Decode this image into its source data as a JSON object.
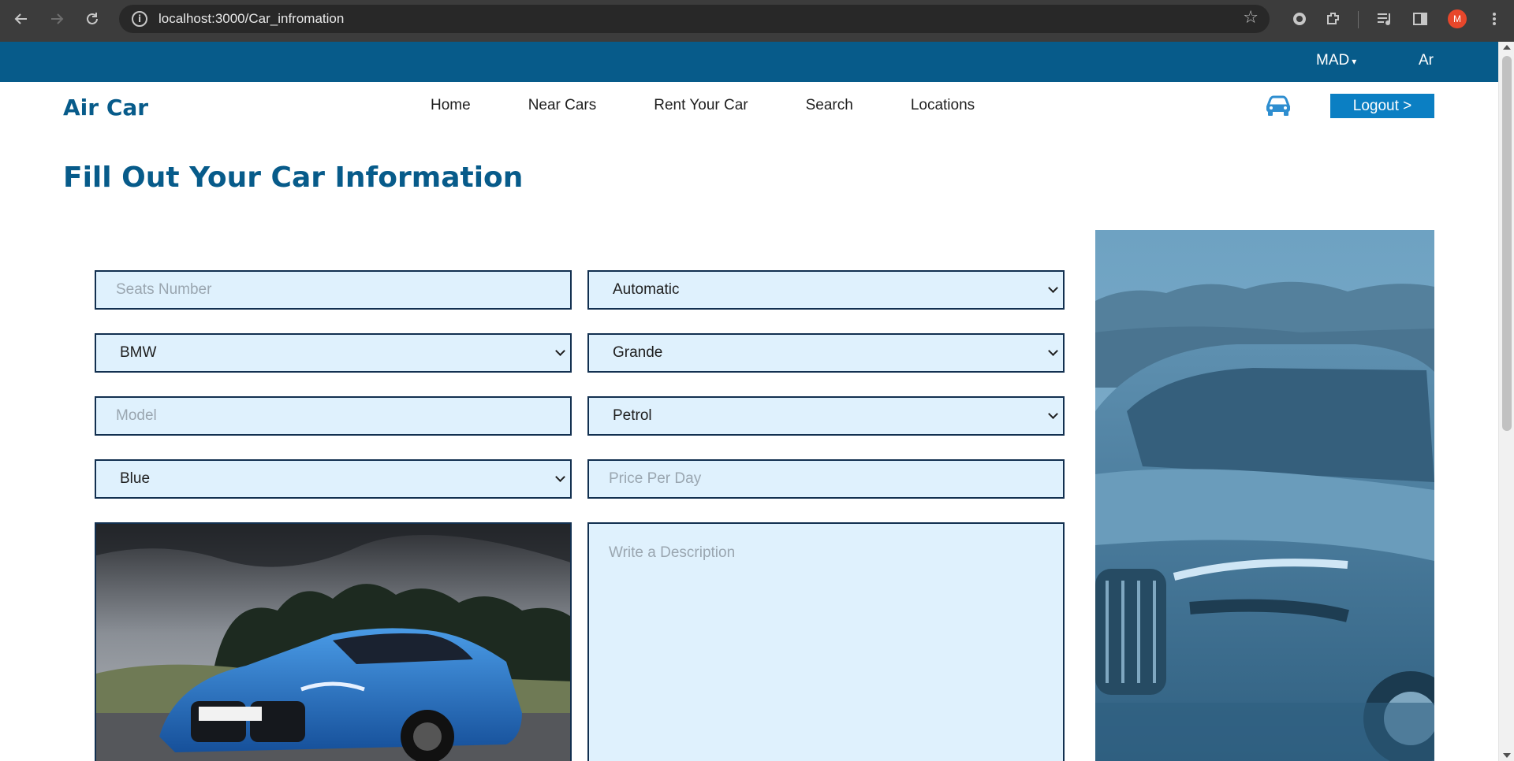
{
  "browser": {
    "url": "localhost:3000/Car_infromation",
    "profile_initial": "M"
  },
  "topbar": {
    "currency": "MAD",
    "language": "Ar"
  },
  "navbar": {
    "logo": "Air Car",
    "links": [
      "Home",
      "Near Cars",
      "Rent Your Car",
      "Search",
      "Locations"
    ],
    "logout_label": "Logout >"
  },
  "page": {
    "title": "Fill Out Your Car Information"
  },
  "form": {
    "seats": {
      "placeholder": "Seats Number"
    },
    "transmission": {
      "value": "Automatic"
    },
    "brand": {
      "value": "BMW"
    },
    "size": {
      "value": "Grande"
    },
    "model": {
      "placeholder": "Model"
    },
    "fuel": {
      "value": "Petrol"
    },
    "color": {
      "value": "Blue"
    },
    "price": {
      "placeholder": "Price Per Day"
    },
    "description": {
      "placeholder": "Write a Description"
    }
  },
  "colors": {
    "brand": "#075b8a",
    "button": "#0b7fc3",
    "field_bg": "#dff1fd",
    "field_border": "#123050"
  },
  "icons": [
    "back-icon",
    "forward-icon",
    "reload-icon",
    "site-info-icon",
    "star-icon",
    "extensions-icon",
    "car-icon"
  ]
}
